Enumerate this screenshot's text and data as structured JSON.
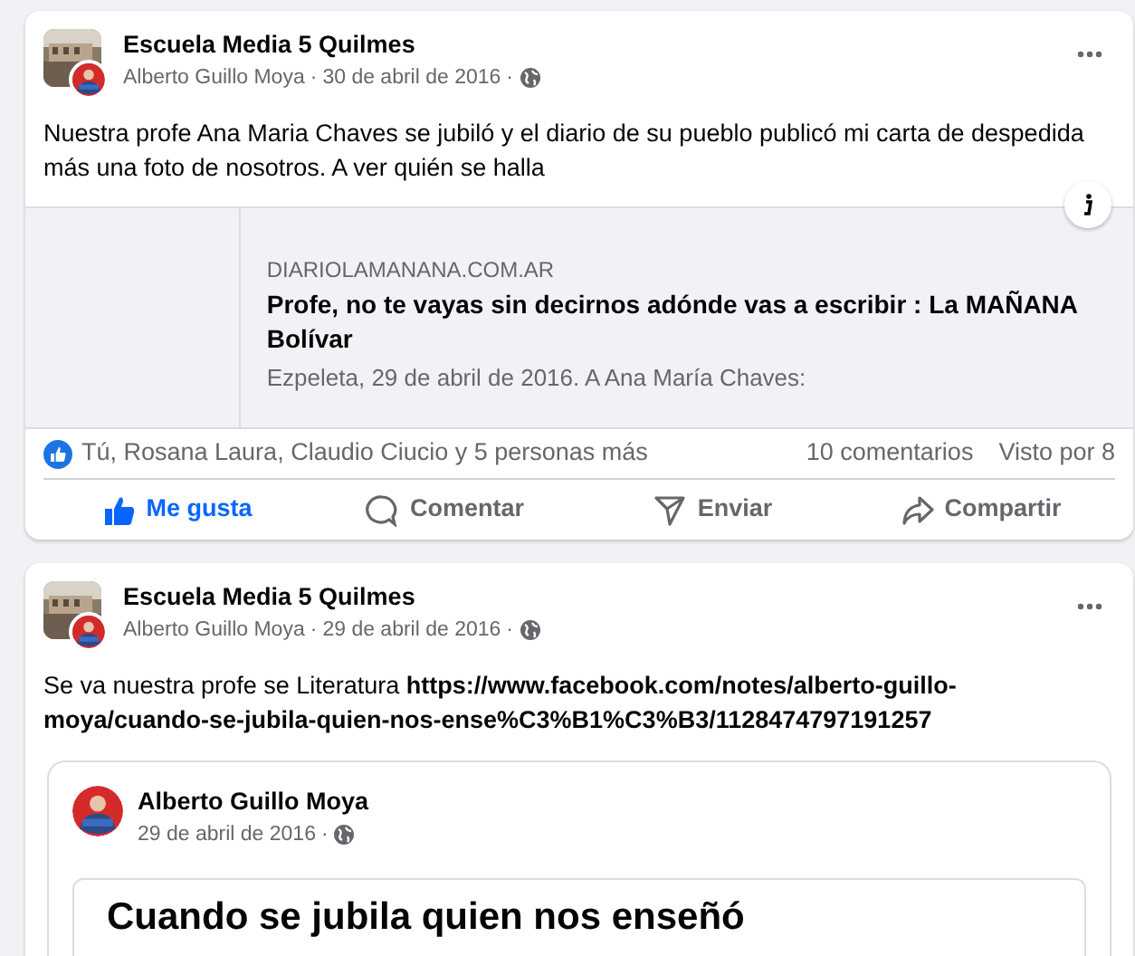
{
  "separator": "·",
  "posts": [
    {
      "page": "Escuela Media 5 Quilmes",
      "author": "Alberto Guillo Moya",
      "date": "30 de abril de 2016",
      "text": "Nuestra profe Ana Maria Chaves se jubiló y el diario de su pueblo publicó mi carta de despedida más una foto de nosotros. A ver quién se halla",
      "link_preview": {
        "domain": "DIARIOLAMANANA.COM.AR",
        "title": "Profe, no te vayas sin decirnos adónde vas a escribir : La MAÑANA Bolívar",
        "description": "Ezpeleta, 29 de abril de 2016. A Ana María Chaves:"
      },
      "reactions": "Tú, Rosana Laura, Claudio Ciucio y 5 personas más",
      "comments": "10 comentarios",
      "seen": "Visto por 8",
      "actions": [
        {
          "kind": "like",
          "label": "Me gusta",
          "selected": true
        },
        {
          "kind": "comment",
          "label": "Comentar",
          "selected": false
        },
        {
          "kind": "send",
          "label": "Enviar",
          "selected": false
        },
        {
          "kind": "share",
          "label": "Compartir",
          "selected": false
        }
      ]
    },
    {
      "page": "Escuela Media 5 Quilmes",
      "author": "Alberto Guillo Moya",
      "date": "29 de abril de 2016",
      "text": "Se va nuestra profe se Literatura **https://www.facebook.com/notes/alberto-guillo-moya/cuando-se-jubila-quien-nos-ense%C3%B1%C3%B3/1128474797191257**",
      "shared_note": {
        "author": "Alberto Guillo Moya",
        "date": "29 de abril de 2016",
        "title": "Cuando se jubila quien nos enseñó"
      }
    }
  ]
}
